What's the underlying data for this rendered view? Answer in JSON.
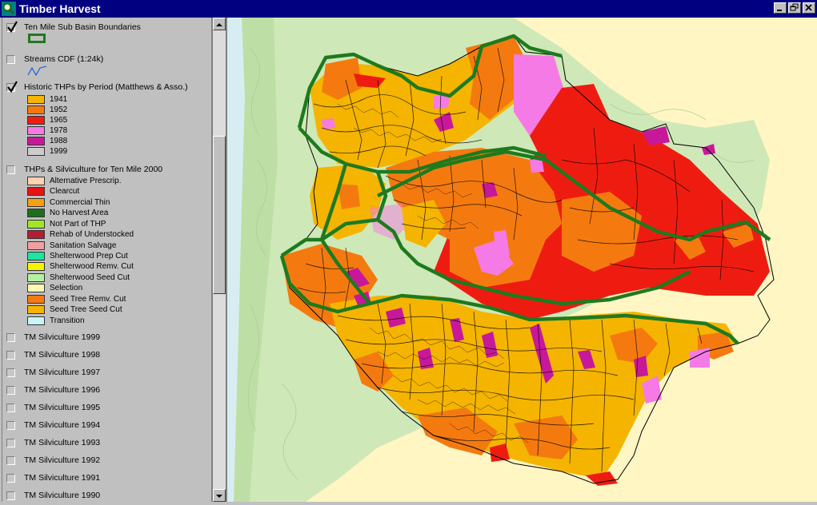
{
  "window": {
    "title": "Timber Harvest",
    "icon": "magnifier-icon"
  },
  "toc": {
    "layers": [
      {
        "label": "Ten Mile Sub Basin Boundaries",
        "checked": true
      },
      {
        "label": "Streams CDF (1:24k)",
        "checked": false
      },
      {
        "label": "Historic THPs by Period (Matthews & Asso.)",
        "checked": true
      },
      {
        "label": "THPs & Silviculture for Ten Mile 2000",
        "checked": false
      }
    ],
    "period_legend": [
      {
        "label": "1941",
        "color": "#f5b400"
      },
      {
        "label": "1952",
        "color": "#f47a10"
      },
      {
        "label": "1965",
        "color": "#ee1c10"
      },
      {
        "label": "1978",
        "color": "#f57ae5"
      },
      {
        "label": "1988",
        "color": "#c8189a"
      },
      {
        "label": "1999",
        "color": "#cccccc"
      }
    ],
    "silviculture_legend": [
      {
        "label": "Alternative Prescrip.",
        "color": "#ffd2b4"
      },
      {
        "label": "Clearcut",
        "color": "#e61414"
      },
      {
        "label": "Commercial Thin",
        "color": "#f5a010"
      },
      {
        "label": "No Harvest Area",
        "color": "#1e6e1e"
      },
      {
        "label": "Not Part of THP",
        "color": "#a0e628"
      },
      {
        "label": "Rehab of Understocked",
        "color": "#b41e32"
      },
      {
        "label": "Sanitation Salvage",
        "color": "#f0a0a0"
      },
      {
        "label": "Shelterwood Prep Cut",
        "color": "#1ee6a0"
      },
      {
        "label": "Shelterwood Remv. Cut",
        "color": "#f5f500"
      },
      {
        "label": "Shelterwood Seed Cut",
        "color": "#b4f0a0"
      },
      {
        "label": "Selection",
        "color": "#fffab4"
      },
      {
        "label": "Seed Tree Remv. Cut",
        "color": "#f57814"
      },
      {
        "label": "Seed Tree Seed Cut",
        "color": "#f5b400"
      },
      {
        "label": "Transition",
        "color": "#c8f5f5"
      }
    ],
    "silviculture_years": [
      "TM Silviculture 1999",
      "TM Silviculture 1998",
      "TM Silviculture 1997",
      "TM Silviculture 1996",
      "TM Silviculture 1995",
      "TM Silviculture 1994",
      "TM Silviculture 1993",
      "TM Silviculture 1992",
      "TM Silviculture 1991",
      "TM Silviculture 1990"
    ]
  },
  "map": {
    "background_color": "#fff6c3",
    "boundary_color": "#1e7a1e"
  }
}
